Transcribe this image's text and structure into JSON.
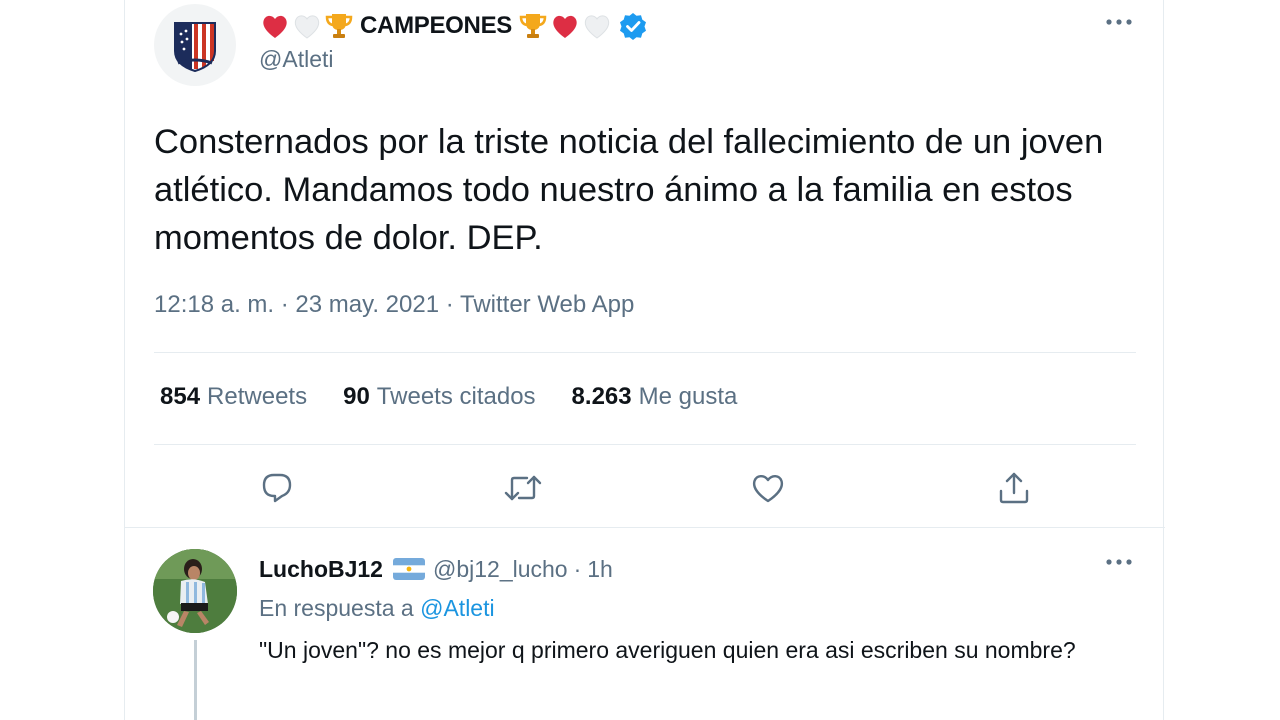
{
  "main_tweet": {
    "display_name": "CAMPEONES",
    "name_emojis_before": [
      "red-heart",
      "white-heart",
      "trophy"
    ],
    "name_emojis_after": [
      "trophy",
      "red-heart",
      "white-heart"
    ],
    "verified": true,
    "handle": "@Atleti",
    "avatar_icon": "atletico-crest-icon",
    "text": "Consternados por la triste noticia del fallecimiento de un joven atlético. Mandamos todo nuestro ánimo a la familia en estos momentos de dolor. DEP.",
    "time": "12:18 a. m.",
    "date": "23 may. 2021",
    "source": "Twitter Web App",
    "stats": {
      "retweets_count": "854",
      "retweets_label": "Retweets",
      "quotes_count": "90",
      "quotes_label": "Tweets citados",
      "likes_count": "8.263",
      "likes_label": "Me gusta"
    },
    "actions": [
      "reply-icon",
      "retweet-icon",
      "like-icon",
      "share-icon"
    ]
  },
  "reply": {
    "display_name": "LuchoBJ12",
    "flag_icon": "argentina-flag-icon",
    "handle": "@bj12_lucho",
    "separator": "·",
    "time": "1h",
    "replying_to_prefix": "En respuesta a",
    "replying_to_mention": "@Atleti",
    "text": "\"Un joven\"? no es mejor q primero averiguen quien era asi escriben su nombre?"
  },
  "colors": {
    "text_primary": "#0f1419",
    "text_secondary": "#5b7083",
    "link": "#1b95e0",
    "verified": "#1d9bf0",
    "divider": "#e6ecf0"
  }
}
